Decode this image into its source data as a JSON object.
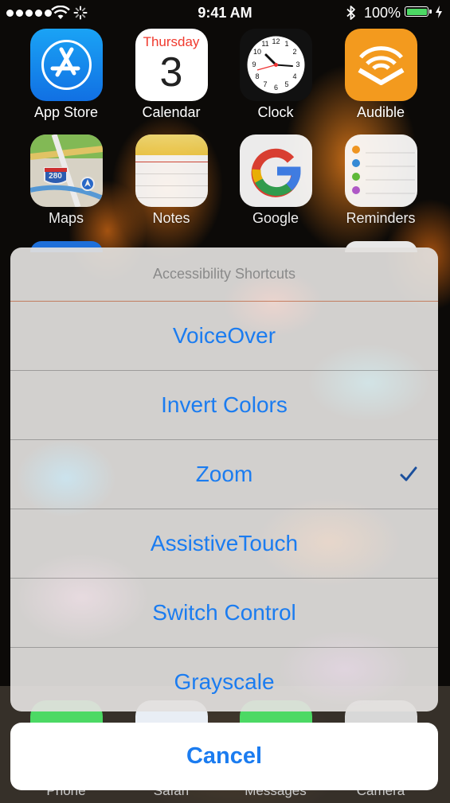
{
  "status_bar": {
    "time": "9:41 AM",
    "battery_percent": "100%",
    "battery_color": "#4cd964"
  },
  "home_screen": {
    "apps": [
      {
        "label": "App Store",
        "icon": "app-store-icon"
      },
      {
        "label": "Calendar",
        "icon": "calendar-icon",
        "weekday": "Thursday",
        "day": "3"
      },
      {
        "label": "Clock",
        "icon": "clock-icon"
      },
      {
        "label": "Audible",
        "icon": "audible-icon"
      },
      {
        "label": "Maps",
        "icon": "maps-icon",
        "route_number": "280"
      },
      {
        "label": "Notes",
        "icon": "notes-icon"
      },
      {
        "label": "Google",
        "icon": "google-icon"
      },
      {
        "label": "Reminders",
        "icon": "reminders-icon"
      }
    ],
    "dock": [
      {
        "label": "Phone",
        "icon": "phone-icon"
      },
      {
        "label": "Safari",
        "icon": "safari-icon"
      },
      {
        "label": "Messages",
        "icon": "messages-icon"
      },
      {
        "label": "Camera",
        "icon": "camera-icon"
      }
    ]
  },
  "action_sheet": {
    "title": "Accessibility Shortcuts",
    "options": [
      {
        "label": "VoiceOver",
        "checked": false
      },
      {
        "label": "Invert Colors",
        "checked": false
      },
      {
        "label": "Zoom",
        "checked": true
      },
      {
        "label": "AssistiveTouch",
        "checked": false
      },
      {
        "label": "Switch Control",
        "checked": false
      },
      {
        "label": "Grayscale",
        "checked": false
      }
    ],
    "cancel_label": "Cancel",
    "accent_color": "#1b7cf0"
  }
}
